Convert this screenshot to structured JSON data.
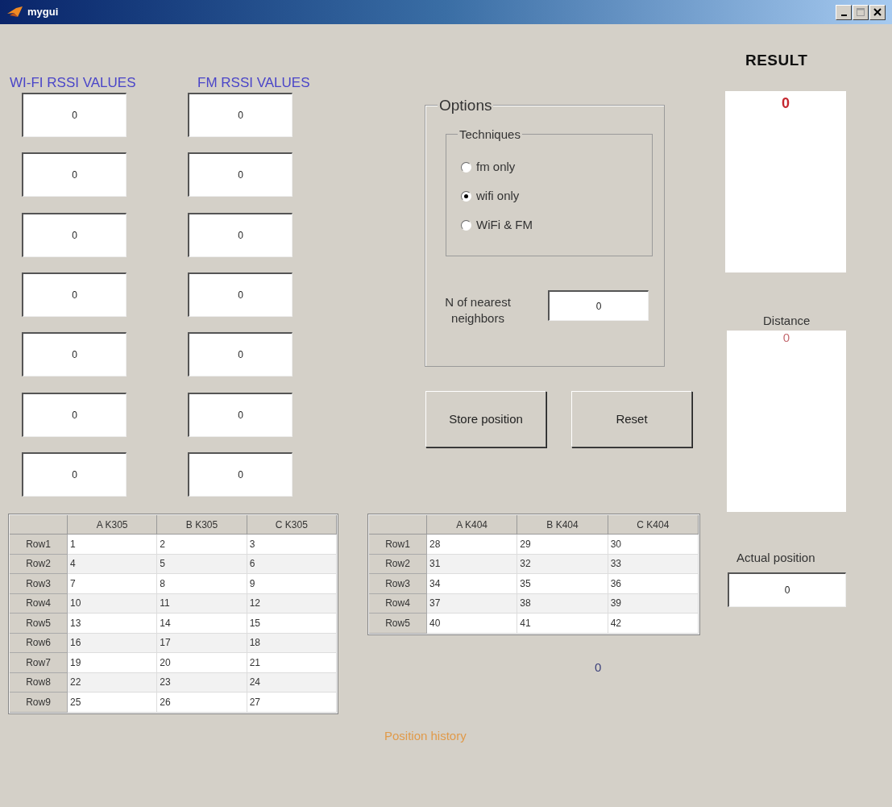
{
  "window": {
    "title": "mygui"
  },
  "wifi_rssi": {
    "label": "WI-FI RSSI VALUES",
    "fields": [
      "0",
      "0",
      "0",
      "0",
      "0",
      "0",
      "0"
    ]
  },
  "fm_rssi": {
    "label": "FM RSSI VALUES",
    "fields": [
      "0",
      "0",
      "0",
      "0",
      "0",
      "0",
      "0"
    ]
  },
  "options": {
    "title": "Options",
    "techniques": {
      "title": "Techniques",
      "radios": [
        {
          "label": "fm only",
          "selected": false
        },
        {
          "label": "wifi only",
          "selected": true
        },
        {
          "label": "WiFi & FM",
          "selected": false
        }
      ]
    },
    "neighbors": {
      "label": "N of nearest neighbors",
      "value": "0"
    }
  },
  "buttons": [
    "Store position",
    "Reset"
  ],
  "result": {
    "label": "RESULT",
    "value": "0"
  },
  "distance": {
    "label": "Distance",
    "value": "0"
  },
  "actual_position": {
    "label": "Actual position",
    "value": "0"
  },
  "tables": [
    {
      "columns": [
        "A K305",
        "B K305",
        "C K305"
      ],
      "rows": [
        {
          "header": "Row1",
          "cells": [
            "1",
            "2",
            "3"
          ]
        },
        {
          "header": "Row2",
          "cells": [
            "4",
            "5",
            "6"
          ]
        },
        {
          "header": "Row3",
          "cells": [
            "7",
            "8",
            "9"
          ]
        },
        {
          "header": "Row4",
          "cells": [
            "10",
            "11",
            "12"
          ]
        },
        {
          "header": "Row5",
          "cells": [
            "13",
            "14",
            "15"
          ]
        },
        {
          "header": "Row6",
          "cells": [
            "16",
            "17",
            "18"
          ]
        },
        {
          "header": "Row7",
          "cells": [
            "19",
            "20",
            "21"
          ]
        },
        {
          "header": "Row8",
          "cells": [
            "22",
            "23",
            "24"
          ]
        },
        {
          "header": "Row9",
          "cells": [
            "25",
            "26",
            "27"
          ]
        }
      ]
    },
    {
      "columns": [
        "A K404",
        "B K404",
        "C K404"
      ],
      "rows": [
        {
          "header": "Row1",
          "cells": [
            "28",
            "29",
            "30"
          ]
        },
        {
          "header": "Row2",
          "cells": [
            "31",
            "32",
            "33"
          ]
        },
        {
          "header": "Row3",
          "cells": [
            "34",
            "35",
            "36"
          ]
        },
        {
          "header": "Row4",
          "cells": [
            "37",
            "38",
            "39"
          ]
        },
        {
          "header": "Row5",
          "cells": [
            "40",
            "41",
            "42"
          ]
        }
      ]
    }
  ],
  "counter": "0",
  "position_history": "Position history"
}
